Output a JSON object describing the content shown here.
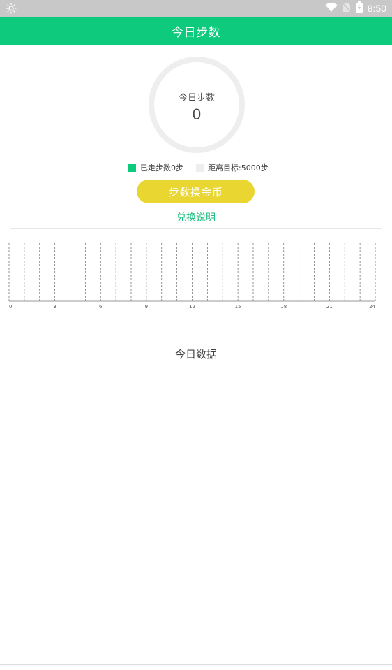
{
  "status_bar": {
    "time": "8:50",
    "icons": [
      "brightness-icon",
      "wifi-icon",
      "no-sim-icon",
      "battery-icon"
    ]
  },
  "app_bar": {
    "title": "今日步数"
  },
  "ring": {
    "label": "今日步数",
    "value": "0"
  },
  "legend": {
    "walked": {
      "label": "已走步数0步",
      "color": "#0dca7d"
    },
    "remaining": {
      "label": "距离目标:5000步",
      "color": "#eeeeee"
    }
  },
  "exchange_button": {
    "label": "步数换金币",
    "color": "#ead630"
  },
  "explain_link": {
    "label": "兑换说明",
    "color": "#1fbf80"
  },
  "chart_data": {
    "type": "bar",
    "x": [
      0,
      1,
      2,
      3,
      4,
      5,
      6,
      7,
      8,
      9,
      10,
      11,
      12,
      13,
      14,
      15,
      16,
      17,
      18,
      19,
      20,
      21,
      22,
      23,
      24
    ],
    "tick_labels": [
      "0",
      "3",
      "6",
      "9",
      "12",
      "15",
      "18",
      "21",
      "24"
    ],
    "tick_values": [
      0,
      3,
      6,
      9,
      12,
      15,
      18,
      21,
      24
    ],
    "values": [
      0,
      0,
      0,
      0,
      0,
      0,
      0,
      0,
      0,
      0,
      0,
      0,
      0,
      0,
      0,
      0,
      0,
      0,
      0,
      0,
      0,
      0,
      0,
      0,
      0
    ],
    "grid": "vertical-dashed",
    "xlim": [
      0,
      24
    ]
  },
  "section": {
    "title": "今日数据"
  }
}
